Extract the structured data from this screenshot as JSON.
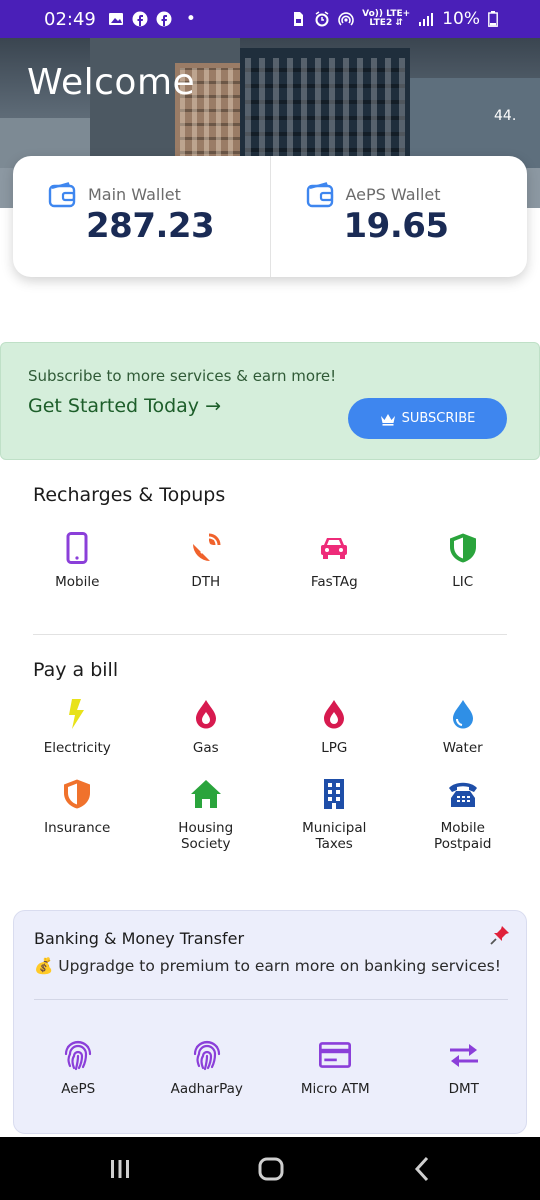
{
  "status_bar": {
    "time": "02:49",
    "dot": "•",
    "network_top": "Vo)) LTE+",
    "network_bottom": "LTE2 ⇵",
    "battery": "10%",
    "icons": [
      "gallery-icon",
      "facebook-icon",
      "facebook-icon",
      "sim-icon",
      "alarm-icon",
      "hotspot-icon",
      "signal-icon",
      "battery-icon"
    ]
  },
  "header": {
    "title": "Welcome",
    "side_text": "44."
  },
  "wallets": {
    "main": {
      "label": "Main Wallet",
      "value": "287.23"
    },
    "aeps": {
      "label": "AePS Wallet",
      "value": "19.65"
    }
  },
  "promo": {
    "subtitle": "Subscribe to more services & earn more!",
    "cta": "Get Started Today →",
    "button": "SUBSCRIBE"
  },
  "recharges": {
    "title": "Recharges & Topups",
    "items": [
      {
        "label": "Mobile",
        "icon": "mobile-phone-icon",
        "color": "#8b3fd9"
      },
      {
        "label": "DTH",
        "icon": "satellite-dish-icon",
        "color": "#f0622c"
      },
      {
        "label": "FasTAg",
        "icon": "car-icon",
        "color": "#ee2b79"
      },
      {
        "label": "LIC",
        "icon": "shield-icon",
        "color": "#2aa43c"
      }
    ]
  },
  "bills": {
    "title": "Pay a bill",
    "row1": [
      {
        "label": "Electricity",
        "icon": "lightning-icon",
        "color": "#e8e21a"
      },
      {
        "label": "Gas",
        "icon": "gas-drop-icon",
        "color": "#d71a4f"
      },
      {
        "label": "LPG",
        "icon": "lpg-drop-icon",
        "color": "#d71a4f"
      },
      {
        "label": "Water",
        "icon": "water-drop-icon",
        "color": "#2f8fe6"
      }
    ],
    "row2": [
      {
        "label": "Insurance",
        "icon": "insurance-shield-icon",
        "color": "#f0722c"
      },
      {
        "label": "Housing Society",
        "icon": "home-icon",
        "color": "#2aa43c"
      },
      {
        "label": "Municipal Taxes",
        "icon": "building-icon",
        "color": "#1e4ea8"
      },
      {
        "label": "Mobile Postpaid",
        "icon": "telephone-icon",
        "color": "#1e4ea8"
      }
    ]
  },
  "banking": {
    "title": "Banking & Money Transfer",
    "message": "💰 Upgradge to premium to earn more on banking services!",
    "items": [
      {
        "label": "AePS",
        "icon": "fingerprint-icon",
        "color": "#8b3fd9"
      },
      {
        "label": "AadharPay",
        "icon": "fingerprint-icon",
        "color": "#8b3fd9"
      },
      {
        "label": "Micro ATM",
        "icon": "card-icon",
        "color": "#8b3fd9"
      },
      {
        "label": "DMT",
        "icon": "transfer-arrows-icon",
        "color": "#8b3fd9"
      }
    ]
  },
  "nav": {
    "buttons": [
      "recents-icon",
      "home-icon",
      "back-icon"
    ]
  }
}
